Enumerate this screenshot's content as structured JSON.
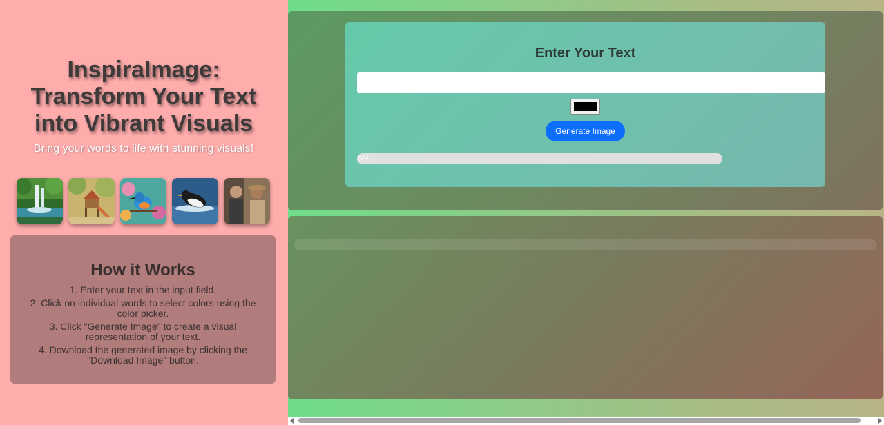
{
  "hero": {
    "title_line1": "InspiraImage:",
    "title_line2": "Transform Your Text",
    "title_line3": "into Vibrant Visuals",
    "subtitle": "Bring your words to life with stunning visuals!"
  },
  "thumbnails": [
    {
      "icon": "waterfall-image"
    },
    {
      "icon": "playground-image"
    },
    {
      "icon": "kingfisher-bird-image"
    },
    {
      "icon": "penguin-image"
    },
    {
      "icon": "people-painting-image"
    }
  ],
  "how_it_works": {
    "title": "How it Works",
    "steps": [
      "1. Enter your text in the input field.",
      "2. Click on individual words to select colors using the color picker.",
      "3. Click \"Generate Image\" to create a visual representation of your text.",
      "4. Download the generated image by clicking the \"Download Image\" button."
    ]
  },
  "form": {
    "title": "Enter Your Text",
    "text_value": "",
    "color_value": "#000000",
    "generate_label": "Generate Image",
    "progress_percent": 0,
    "progress_label": "0%"
  },
  "colors": {
    "button": "#0d6efd",
    "left_bg": "#ffacac"
  }
}
